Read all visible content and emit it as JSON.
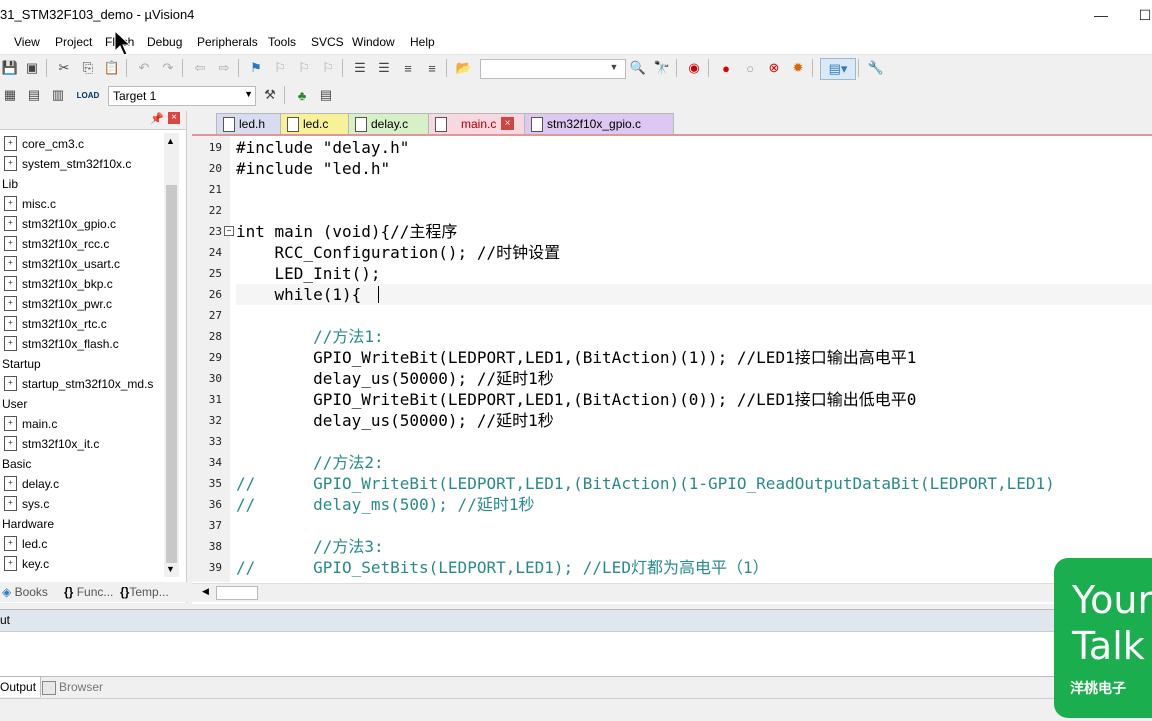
{
  "window": {
    "title": "31_STM32F103_demo  - µVision4",
    "minimize": "—",
    "maximize": "☐"
  },
  "menu": [
    "View",
    "Project",
    "Flash",
    "Debug",
    "Peripherals",
    "Tools",
    "SVCS",
    "Window",
    "Help"
  ],
  "toolbar2": {
    "target": "Target 1"
  },
  "project_tree": [
    {
      "type": "file",
      "label": "core_cm3.c"
    },
    {
      "type": "file",
      "label": "system_stm32f10x.c"
    },
    {
      "type": "group",
      "label": "Lib"
    },
    {
      "type": "file",
      "label": "misc.c"
    },
    {
      "type": "file",
      "label": "stm32f10x_gpio.c"
    },
    {
      "type": "file",
      "label": "stm32f10x_rcc.c"
    },
    {
      "type": "file",
      "label": "stm32f10x_usart.c"
    },
    {
      "type": "file",
      "label": "stm32f10x_bkp.c"
    },
    {
      "type": "file",
      "label": "stm32f10x_pwr.c"
    },
    {
      "type": "file",
      "label": "stm32f10x_rtc.c"
    },
    {
      "type": "file",
      "label": "stm32f10x_flash.c"
    },
    {
      "type": "group",
      "label": "Startup"
    },
    {
      "type": "file",
      "label": "startup_stm32f10x_md.s"
    },
    {
      "type": "group",
      "label": "User"
    },
    {
      "type": "file",
      "label": "main.c"
    },
    {
      "type": "file",
      "label": "stm32f10x_it.c"
    },
    {
      "type": "group",
      "label": "Basic"
    },
    {
      "type": "file",
      "label": "delay.c"
    },
    {
      "type": "file",
      "label": "sys.c"
    },
    {
      "type": "group",
      "label": "Hardware"
    },
    {
      "type": "file",
      "label": "led.c"
    },
    {
      "type": "file",
      "label": "key.c"
    }
  ],
  "panel_tabs": [
    "Books",
    "Func...",
    "Temp..."
  ],
  "tabs": [
    {
      "label": "led.h",
      "color": "#d8dcf0"
    },
    {
      "label": "led.c",
      "color": "#f7f29a"
    },
    {
      "label": "delay.c",
      "color": "#d8f0c8"
    },
    {
      "label": "main.c",
      "color": "#f8d8e0",
      "active": true
    },
    {
      "label": "stm32f10x_gpio.c",
      "color": "#dcc8f0"
    }
  ],
  "code_lines": [
    {
      "n": "19",
      "text": "#include \"delay.h\""
    },
    {
      "n": "20",
      "text": "#include \"led.h\""
    },
    {
      "n": "21",
      "text": ""
    },
    {
      "n": "22",
      "text": ""
    },
    {
      "n": "23",
      "text": "int main (void){//主程序"
    },
    {
      "n": "24",
      "text": "    RCC_Configuration(); //时钟设置"
    },
    {
      "n": "25",
      "text": "    LED_Init();"
    },
    {
      "n": "26",
      "text": "    while(1){"
    },
    {
      "n": "27",
      "text": ""
    },
    {
      "n": "28",
      "text": "        //方法1:"
    },
    {
      "n": "29",
      "text": "        GPIO_WriteBit(LEDPORT,LED1,(BitAction)(1)); //LED1接口输出高电平1"
    },
    {
      "n": "30",
      "text": "        delay_us(50000); //延时1秒"
    },
    {
      "n": "31",
      "text": "        GPIO_WriteBit(LEDPORT,LED1,(BitAction)(0)); //LED1接口输出低电平0"
    },
    {
      "n": "32",
      "text": "        delay_us(50000); //延时1秒"
    },
    {
      "n": "33",
      "text": ""
    },
    {
      "n": "34",
      "text": "        //方法2:"
    },
    {
      "n": "35",
      "text": "//      GPIO_WriteBit(LEDPORT,LED1,(BitAction)(1-GPIO_ReadOutputDataBit(LEDPORT,LED1)"
    },
    {
      "n": "36",
      "text": "//      delay_ms(500); //延时1秒"
    },
    {
      "n": "37",
      "text": ""
    },
    {
      "n": "38",
      "text": "        //方法3:"
    },
    {
      "n": "39",
      "text": "//      GPIO_SetBits(LEDPORT,LED1); //LED灯都为高电平（1）"
    }
  ],
  "output": {
    "header": "ut",
    "tab_output": "Output",
    "tab_browser": "Browser"
  },
  "watermark": {
    "line1": "Your",
    "line2": "Talk",
    "line3": "洋桃电子"
  }
}
